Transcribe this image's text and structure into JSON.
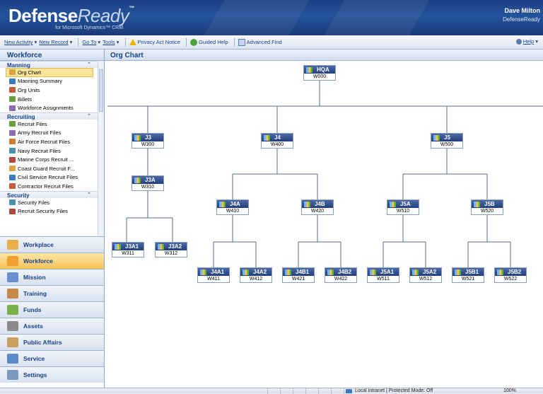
{
  "header": {
    "logo_main": "Defense",
    "logo_accent": "Ready",
    "logo_tm": "™",
    "logo_sub": "for Microsoft Dynamics™ CRM",
    "user_name": "Dave Milton",
    "user_org": "DefenseReady"
  },
  "toolbar": {
    "new_activity": "New Activity",
    "new_record": "New Record",
    "go_to": "Go To",
    "tools": "Tools",
    "privacy": "Privacy Act Notice",
    "guided_help": "Guided Help",
    "advanced_find": "Advanced Find",
    "help": "Help"
  },
  "nav": {
    "title": "Workforce",
    "groups": [
      {
        "label": "Manning",
        "items": [
          "Org Chart",
          "Manning Summary",
          "Org Units",
          "Billets",
          "Workforce Assignments"
        ]
      },
      {
        "label": "Recruiting",
        "items": [
          "Recruit Files",
          "Army Recruit Files",
          "Air Force Recruit Files",
          "Navy Recruit Files",
          "Marine Corps Recruit ...",
          "Coast Guard Recruit F...",
          "Civil Service Recruit Files",
          "Contractor Recruit Files"
        ]
      },
      {
        "label": "Security",
        "items": [
          "Security Files",
          "Recruit Security Files"
        ]
      }
    ],
    "selected_item": "Org Chart",
    "sections": [
      "Workplace",
      "Workforce",
      "Mission",
      "Training",
      "Funds",
      "Assets",
      "Public Affairs",
      "Service",
      "Settings"
    ],
    "active_section": "Workforce"
  },
  "main": {
    "title": "Org Chart"
  },
  "org_chart": {
    "nodes": [
      {
        "name": "HQA",
        "code": "W000"
      },
      {
        "name": "J3",
        "code": "W300"
      },
      {
        "name": "J4",
        "code": "W400"
      },
      {
        "name": "J5",
        "code": "W500"
      },
      {
        "name": "J3A",
        "code": "W310"
      },
      {
        "name": "J3A1",
        "code": "W311"
      },
      {
        "name": "J3A2",
        "code": "W312"
      },
      {
        "name": "J4A",
        "code": "W410"
      },
      {
        "name": "J4B",
        "code": "W420"
      },
      {
        "name": "J5A",
        "code": "W510"
      },
      {
        "name": "J5B",
        "code": "W520"
      },
      {
        "name": "J4A1",
        "code": "W411"
      },
      {
        "name": "J4A2",
        "code": "W412"
      },
      {
        "name": "J4B1",
        "code": "W421"
      },
      {
        "name": "J4B2",
        "code": "W422"
      },
      {
        "name": "J5A1",
        "code": "W511"
      },
      {
        "name": "J5A2",
        "code": "W512"
      },
      {
        "name": "J5B1",
        "code": "W521"
      },
      {
        "name": "J5B2",
        "code": "W522"
      }
    ]
  },
  "status": {
    "zone": "Local intranet | Protected Mode: Off",
    "zoom": "100%"
  }
}
